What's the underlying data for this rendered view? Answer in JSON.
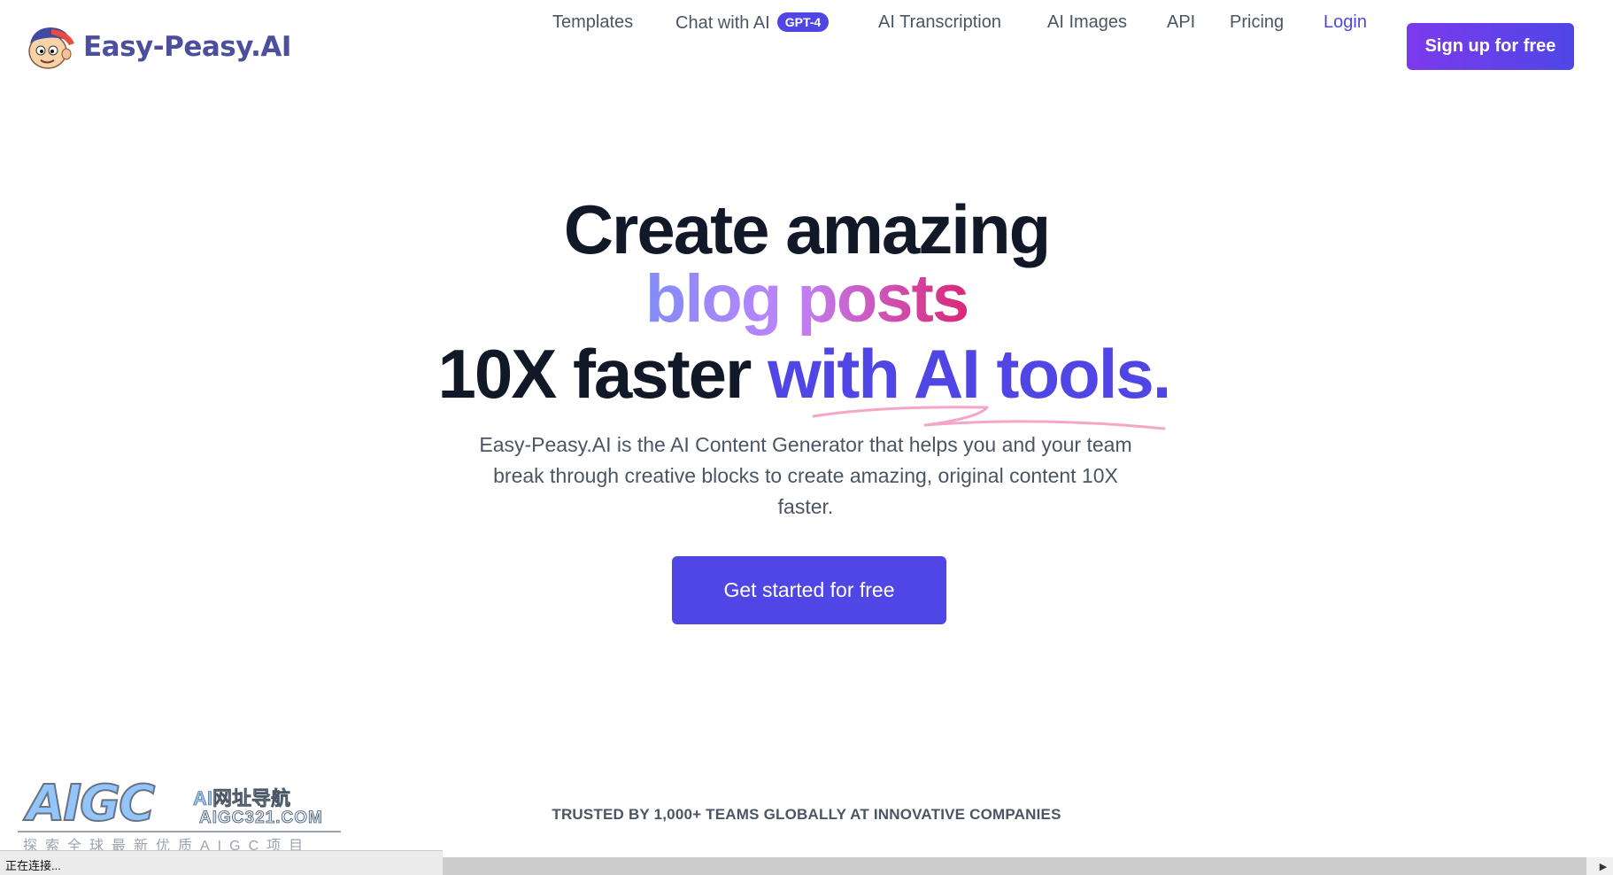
{
  "brand": {
    "name": "Easy-Peasy.AI"
  },
  "nav": {
    "templates": "Templates",
    "chat": "Chat with AI",
    "chat_badge": "GPT-4",
    "transcription": "AI Transcription",
    "images": "AI Images",
    "api": "API",
    "pricing": "Pricing",
    "login": "Login",
    "signup": "Sign up for free"
  },
  "hero": {
    "line1": "Create amazing",
    "line2": "blog posts",
    "line3_plain": "10X faster ",
    "line3_accent": "with AI tools.",
    "subtitle": "Easy-Peasy.AI is the AI Content Generator that helps you and your team break through creative blocks to create amazing, original content 10X faster.",
    "cta": "Get started for free"
  },
  "trusted": "TRUSTED BY 1,000+ TEAMS GLOBALLY AT INNOVATIVE COMPANIES",
  "watermark": {
    "logo": "AIGC",
    "cn": "AI网址导航",
    "url": "AIGC321.COM",
    "slogan": "探索全球最新优质AIGC项目"
  },
  "statusbar": {
    "text": "正在连接..."
  },
  "colors": {
    "primary": "#4f46e5",
    "signup_gradient_start": "#7c3aed",
    "text_dark": "#111827",
    "text_gray": "#4b5563"
  },
  "icons": {
    "mascot": "mascot-face-icon",
    "scroll_right": "arrow-right-icon"
  }
}
